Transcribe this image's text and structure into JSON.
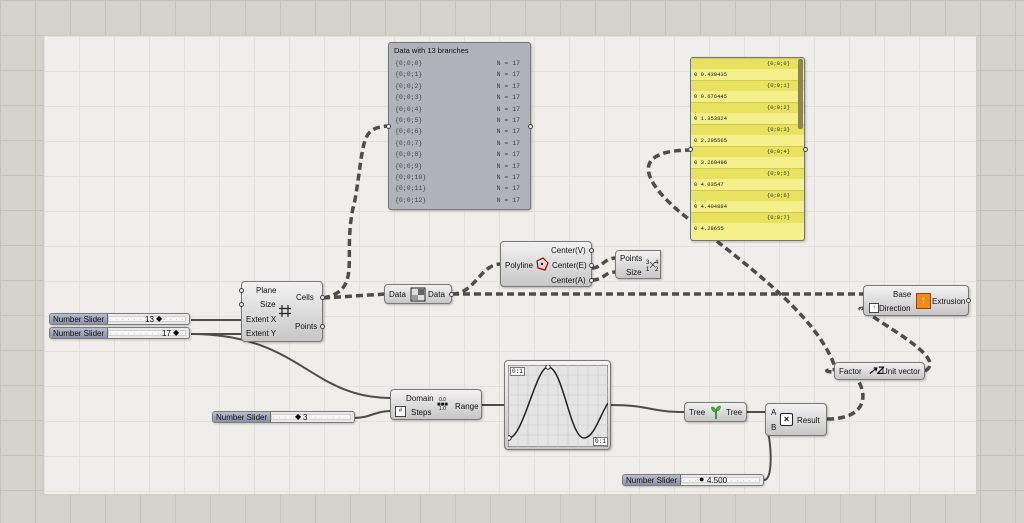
{
  "sliders": [
    {
      "name": "Number Slider",
      "value": "13"
    },
    {
      "name": "Number Slider",
      "value": "17"
    },
    {
      "name": "Number Slider",
      "value": "3"
    },
    {
      "name": "Number Slider",
      "value": "4.500"
    }
  ],
  "slider_track_text": "· · · · · · · · · · · · · · · · · · · · · · · · · · · ·",
  "grid_component": {
    "inputs": [
      "Plane",
      "Size",
      "Extent X",
      "Extent Y"
    ],
    "outputs": [
      "Cells",
      "Points"
    ],
    "icon": "hexagon-grid-icon"
  },
  "data_component": {
    "input": "Data",
    "output": "Data",
    "icon": "data-icon"
  },
  "polyline_component": {
    "input": "Polyline",
    "outputs": [
      "Center(V)",
      "Center(E)",
      "Center(A)"
    ],
    "icon": "polygon-center-icon"
  },
  "points_component": {
    "inputs": [
      "Points",
      "Size"
    ],
    "icon": "point-list-icon"
  },
  "range_component": {
    "inputs": [
      "Domain",
      "Steps"
    ],
    "output": "Range",
    "icon": "range-icon",
    "icon_text_top": "0.0",
    "icon_text_bottom": "1.0"
  },
  "graph_mapper": {
    "corner_top": "0:1",
    "corner_bottom": "0:1"
  },
  "tree_component": {
    "input": "Tree",
    "output": "Tree",
    "icon": "tree-icon"
  },
  "multiply_component": {
    "inputs": [
      "A",
      "B"
    ],
    "output": "Result",
    "icon": "multiply-icon"
  },
  "unit_z_component": {
    "input": "Factor",
    "output": "Unit vector",
    "icon": "unit-z-icon"
  },
  "extrusion_component": {
    "inputs": [
      "Base",
      "Direction"
    ],
    "output": "Extrusion",
    "icon": "extrusion-icon"
  },
  "panel_gray": {
    "title": "Data with 13 branches",
    "rows": [
      {
        "path": "{0;0;0}",
        "count": "N = 17"
      },
      {
        "path": "{0;0;1}",
        "count": "N = 17"
      },
      {
        "path": "{0;0;2}",
        "count": "N = 17"
      },
      {
        "path": "{0;0;3}",
        "count": "N = 17"
      },
      {
        "path": "{0;0;4}",
        "count": "N = 17"
      },
      {
        "path": "{0;0;5}",
        "count": "N = 17"
      },
      {
        "path": "{0;0;6}",
        "count": "N = 17"
      },
      {
        "path": "{0;0;7}",
        "count": "N = 17"
      },
      {
        "path": "{0;0;8}",
        "count": "N = 17"
      },
      {
        "path": "{0;0;9}",
        "count": "N = 17"
      },
      {
        "path": "{0;0;10}",
        "count": "N = 17"
      },
      {
        "path": "{0;0;11}",
        "count": "N = 17"
      },
      {
        "path": "{0;0;12}",
        "count": "N = 17"
      }
    ]
  },
  "panel_yellow": {
    "branches": [
      {
        "path": "{0;0;0}",
        "value": "0 0.430435"
      },
      {
        "path": "{0;0;1}",
        "value": "0 0.676445"
      },
      {
        "path": "{0;0;2}",
        "value": "0 1.353824"
      },
      {
        "path": "{0;0;3}",
        "value": "0 2.295565"
      },
      {
        "path": "{0;0;4}",
        "value": "0 3.269496"
      },
      {
        "path": "{0;0;5}",
        "value": "0 4.03547"
      },
      {
        "path": "{0;0;6}",
        "value": "0 4.404884"
      },
      {
        "path": "{0;0;7}",
        "value": "0 4.28655"
      }
    ]
  },
  "colors": {
    "wire": "#4d4d4d",
    "panel_yellow": "#f5f08c",
    "slider_name": "#9ea2b8"
  }
}
